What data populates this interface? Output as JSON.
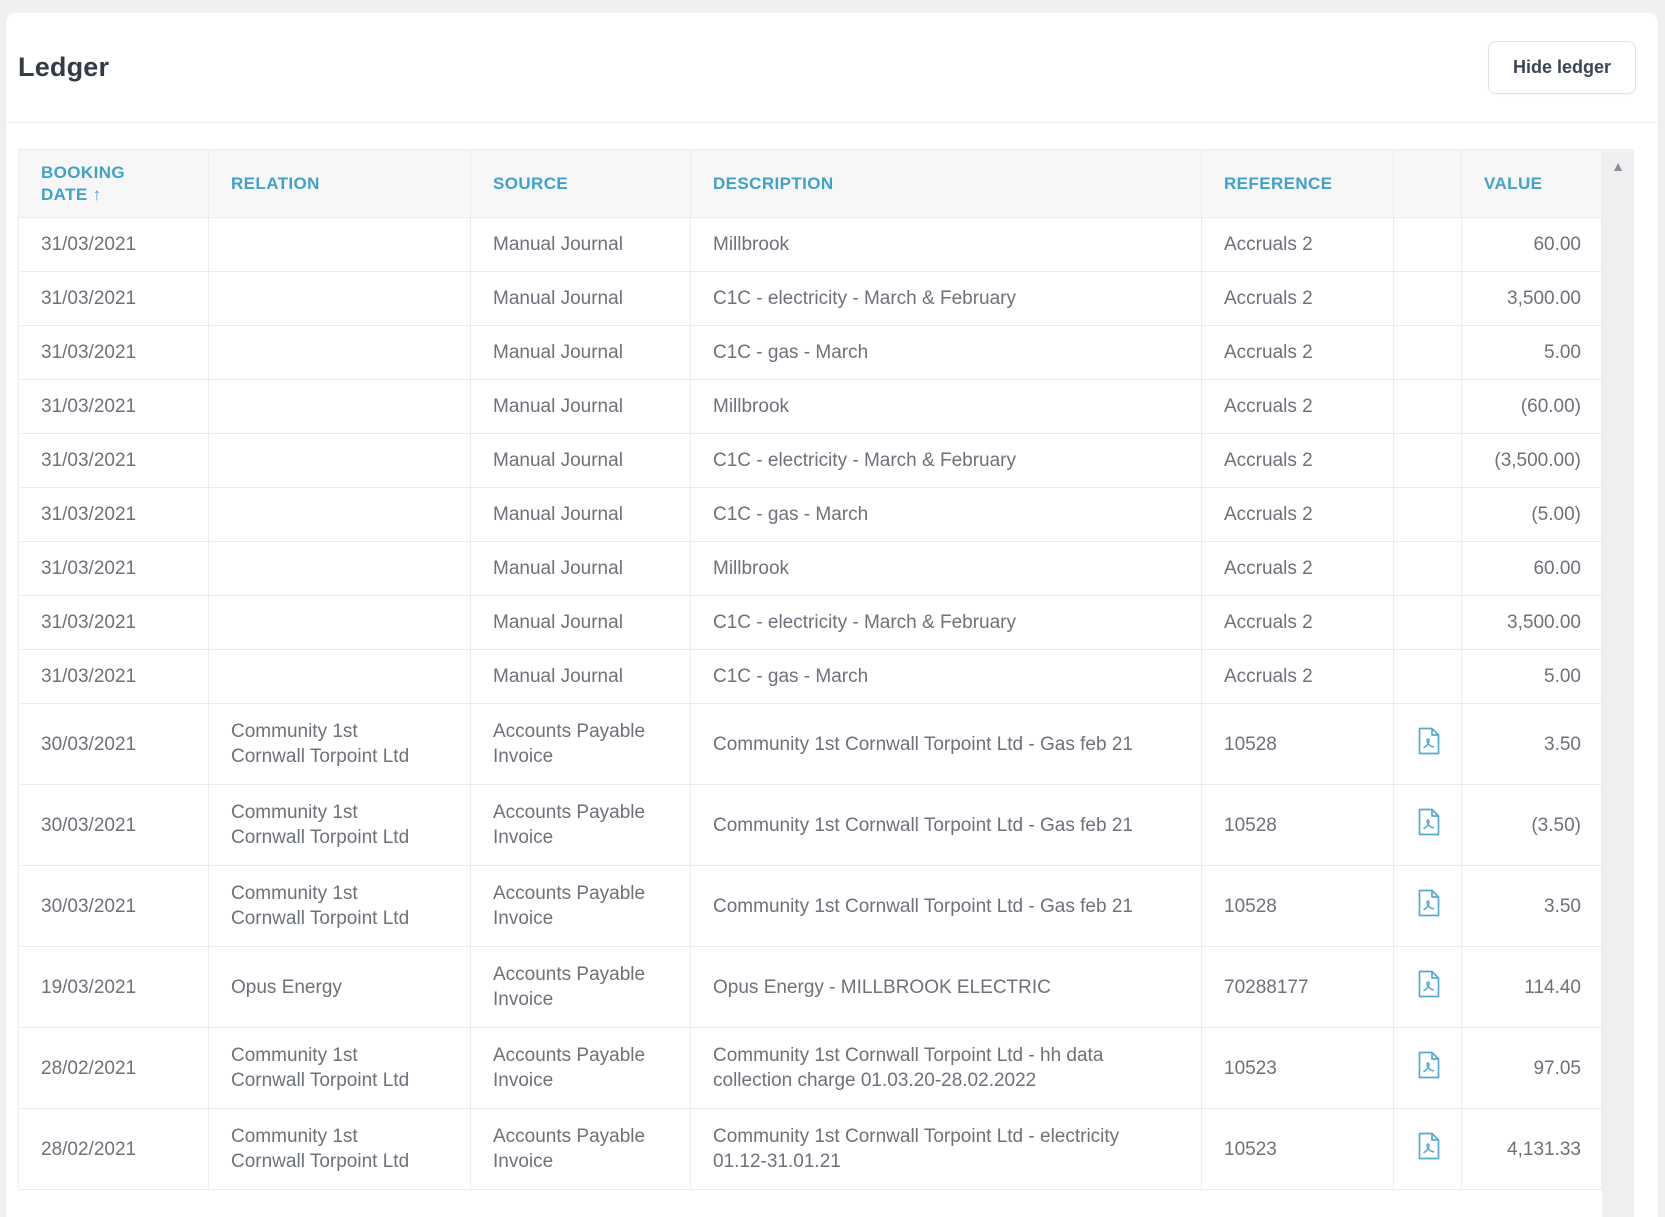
{
  "page": {
    "title": "Ledger",
    "hide_button_label": "Hide ledger"
  },
  "colors": {
    "accent_blue": "#41a1ca",
    "cell_text": "#6d717a",
    "title_text": "#333b49",
    "header_bg": "#f7f7f8",
    "border": "#ececef",
    "page_bg": "#f0f0f2",
    "pdf_icon": "#55aacf",
    "scroll_arrow": "#8e9094"
  },
  "icons": {
    "sort_asc": "↑",
    "scroll_up": "▲",
    "attachment": "pdf-file"
  },
  "table": {
    "columns": [
      {
        "key": "booking_date",
        "label": "BOOKING DATE",
        "sorted": "ascending"
      },
      {
        "key": "relation",
        "label": "RELATION"
      },
      {
        "key": "source",
        "label": "SOURCE"
      },
      {
        "key": "description",
        "label": "DESCRIPTION"
      },
      {
        "key": "reference",
        "label": "REFERENCE"
      },
      {
        "key": "attachment",
        "label": ""
      },
      {
        "key": "value",
        "label": "VALUE"
      }
    ],
    "rows": [
      {
        "booking_date": "31/03/2021",
        "relation": "",
        "source": "Manual Journal",
        "description": "Millbrook",
        "reference": "Accruals 2",
        "attachment": false,
        "value": "60.00"
      },
      {
        "booking_date": "31/03/2021",
        "relation": "",
        "source": "Manual Journal",
        "description": "C1C - electricity - March & February",
        "reference": "Accruals 2",
        "attachment": false,
        "value": "3,500.00"
      },
      {
        "booking_date": "31/03/2021",
        "relation": "",
        "source": "Manual Journal",
        "description": "C1C - gas - March",
        "reference": "Accruals 2",
        "attachment": false,
        "value": "5.00"
      },
      {
        "booking_date": "31/03/2021",
        "relation": "",
        "source": "Manual Journal",
        "description": "Millbrook",
        "reference": "Accruals 2",
        "attachment": false,
        "value": "(60.00)"
      },
      {
        "booking_date": "31/03/2021",
        "relation": "",
        "source": "Manual Journal",
        "description": "C1C - electricity - March & February",
        "reference": "Accruals 2",
        "attachment": false,
        "value": "(3,500.00)"
      },
      {
        "booking_date": "31/03/2021",
        "relation": "",
        "source": "Manual Journal",
        "description": "C1C - gas - March",
        "reference": "Accruals 2",
        "attachment": false,
        "value": "(5.00)"
      },
      {
        "booking_date": "31/03/2021",
        "relation": "",
        "source": "Manual Journal",
        "description": "Millbrook",
        "reference": "Accruals 2",
        "attachment": false,
        "value": "60.00"
      },
      {
        "booking_date": "31/03/2021",
        "relation": "",
        "source": "Manual Journal",
        "description": "C1C - electricity - March & February",
        "reference": "Accruals 2",
        "attachment": false,
        "value": "3,500.00"
      },
      {
        "booking_date": "31/03/2021",
        "relation": "",
        "source": "Manual Journal",
        "description": "C1C - gas - March",
        "reference": "Accruals 2",
        "attachment": false,
        "value": "5.00"
      },
      {
        "booking_date": "30/03/2021",
        "relation": "Community 1st Cornwall Torpoint Ltd",
        "source": "Accounts Payable Invoice",
        "description": "Community 1st Cornwall Torpoint Ltd - Gas feb 21",
        "reference": "10528",
        "attachment": true,
        "value": "3.50"
      },
      {
        "booking_date": "30/03/2021",
        "relation": "Community 1st Cornwall Torpoint Ltd",
        "source": "Accounts Payable Invoice",
        "description": "Community 1st Cornwall Torpoint Ltd - Gas feb 21",
        "reference": "10528",
        "attachment": true,
        "value": "(3.50)"
      },
      {
        "booking_date": "30/03/2021",
        "relation": "Community 1st Cornwall Torpoint Ltd",
        "source": "Accounts Payable Invoice",
        "description": "Community 1st Cornwall Torpoint Ltd - Gas feb 21",
        "reference": "10528",
        "attachment": true,
        "value": "3.50"
      },
      {
        "booking_date": "19/03/2021",
        "relation": "Opus Energy",
        "source": "Accounts Payable Invoice",
        "description": "Opus Energy - MILLBROOK ELECTRIC",
        "reference": "70288177",
        "attachment": true,
        "value": "114.40"
      },
      {
        "booking_date": "28/02/2021",
        "relation": "Community 1st Cornwall Torpoint Ltd",
        "source": "Accounts Payable Invoice",
        "description": "Community 1st Cornwall Torpoint Ltd - hh data collection charge 01.03.20-28.02.2022",
        "reference": "10523",
        "attachment": true,
        "value": "97.05"
      },
      {
        "booking_date": "28/02/2021",
        "relation": "Community 1st Cornwall Torpoint Ltd",
        "source": "Accounts Payable Invoice",
        "description": "Community 1st Cornwall Torpoint Ltd - electricity 01.12-31.01.21",
        "reference": "10523",
        "attachment": true,
        "value": "4,131.33"
      }
    ]
  }
}
